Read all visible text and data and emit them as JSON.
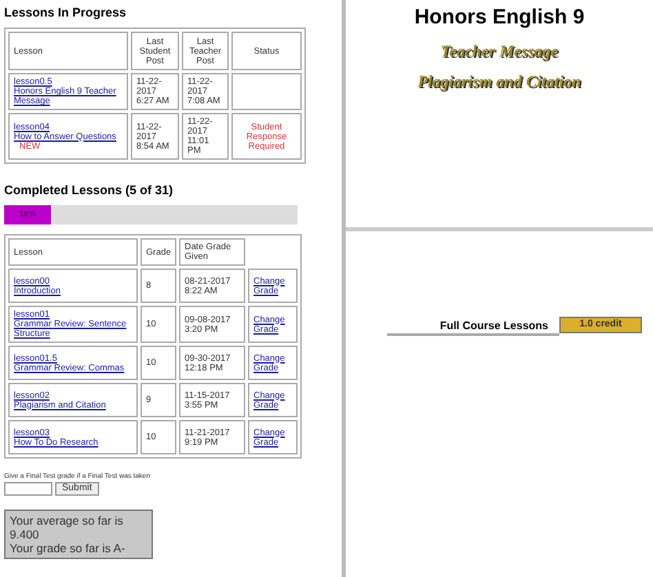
{
  "in_progress": {
    "title": "Lessons In Progress",
    "columns": [
      "Lesson",
      "Last Student Post",
      "Last Teacher Post",
      "Status"
    ],
    "rows": [
      {
        "lesson_id": "lesson0.5",
        "lesson_name": "Honors English 9 Teacher Message",
        "student_post": "11-22-2017 6:27 AM",
        "teacher_post": "11-22-2017 7:08 AM"
      },
      {
        "lesson_id": "lesson04",
        "lesson_name": "How to Answer Questions",
        "new_label": "NEW",
        "student_post": "11-22-2017 8:54 AM",
        "teacher_post": "11-22-2017 11:01 PM",
        "status": "Student Response Required"
      }
    ]
  },
  "completed": {
    "title": "Completed Lessons (5 of 31)",
    "progress": {
      "label": "16%",
      "level": 0.16
    },
    "columns": [
      "Lesson",
      "Grade",
      "Date Grade Given"
    ],
    "rows": [
      {
        "lesson_id": "lesson00",
        "lesson_name": "Introduction",
        "grade": "8",
        "date": "08-21-2017 8:22 AM",
        "action": "Change Grade"
      },
      {
        "lesson_id": "lesson01",
        "lesson_name": "Grammar Review: Sentence Structure",
        "grade": "10",
        "date": "09-08-2017 3:20 PM",
        "action": "Change Grade"
      },
      {
        "lesson_id": "lesson01.5",
        "lesson_name": "Grammar Review: Commas",
        "grade": "10",
        "date": "09-30-2017 12:18 PM",
        "action": "Change Grade"
      },
      {
        "lesson_id": "lesson02",
        "lesson_name": "Plagiarism and Citation",
        "grade": "9",
        "date": "11-15-2017 3:55 PM",
        "action": "Change Grade"
      },
      {
        "lesson_id": "lesson03",
        "lesson_name": "How To Do Research",
        "grade": "10",
        "date": "11-21-2017 9:19 PM",
        "action": "Change Grade"
      }
    ]
  },
  "final_test": {
    "prompt": "Give a Final Test grade if a Final Test was taken",
    "submit": "Submit"
  },
  "summary": [
    "Your average so far is 9.400",
    "Your grade so far is A-"
  ],
  "course": {
    "title": "Honors English 9",
    "messages": [
      "Teacher Message",
      "Plagiarism and Citation"
    ]
  },
  "credit": {
    "label": "Full Course Lessons",
    "value": "1.0 credit"
  }
}
